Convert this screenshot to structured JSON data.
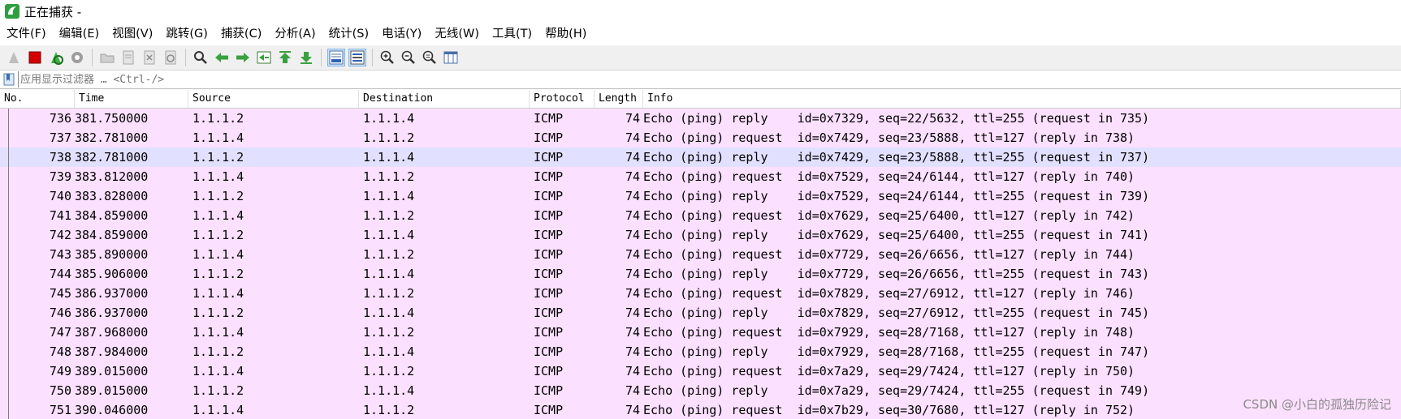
{
  "window": {
    "title": "正在捕获 -"
  },
  "menu": [
    "文件(F)",
    "编辑(E)",
    "视图(V)",
    "跳转(G)",
    "捕获(C)",
    "分析(A)",
    "统计(S)",
    "电话(Y)",
    "无线(W)",
    "工具(T)",
    "帮助(H)"
  ],
  "toolbar": [
    {
      "name": "start-capture-icon",
      "group": 1
    },
    {
      "name": "stop-capture-icon",
      "group": 1
    },
    {
      "name": "restart-capture-icon",
      "group": 1
    },
    {
      "name": "capture-options-icon",
      "group": 1
    },
    {
      "name": "open-file-icon",
      "group": 2
    },
    {
      "name": "save-file-icon",
      "group": 2
    },
    {
      "name": "close-file-icon",
      "group": 2
    },
    {
      "name": "reload-file-icon",
      "group": 2
    },
    {
      "name": "find-packet-icon",
      "group": 3
    },
    {
      "name": "go-back-icon",
      "group": 3
    },
    {
      "name": "go-forward-icon",
      "group": 3
    },
    {
      "name": "go-to-packet-icon",
      "group": 3
    },
    {
      "name": "go-first-icon",
      "group": 3
    },
    {
      "name": "go-last-icon",
      "group": 3
    },
    {
      "name": "auto-scroll-icon",
      "group": 4,
      "pressed": true
    },
    {
      "name": "colorize-icon",
      "group": 4,
      "pressed": true
    },
    {
      "name": "zoom-in-icon",
      "group": 5
    },
    {
      "name": "zoom-out-icon",
      "group": 5
    },
    {
      "name": "zoom-normal-icon",
      "group": 5
    },
    {
      "name": "resize-columns-icon",
      "group": 5
    }
  ],
  "filter": {
    "placeholder": "应用显示过滤器 … <Ctrl-/>"
  },
  "columns": [
    "No.",
    "Time",
    "Source",
    "Destination",
    "Protocol",
    "Length",
    "Info"
  ],
  "packets": [
    {
      "no": "736",
      "time": "381.750000",
      "src": "1.1.1.2",
      "dst": "1.1.1.4",
      "proto": "ICMP",
      "len": "74",
      "info": "Echo (ping) reply    id=0x7329, seq=22/5632, ttl=255 (request in 735)"
    },
    {
      "no": "737",
      "time": "382.781000",
      "src": "1.1.1.4",
      "dst": "1.1.1.2",
      "proto": "ICMP",
      "len": "74",
      "info": "Echo (ping) request  id=0x7429, seq=23/5888, ttl=127 (reply in 738)"
    },
    {
      "no": "738",
      "time": "382.781000",
      "src": "1.1.1.2",
      "dst": "1.1.1.4",
      "proto": "ICMP",
      "len": "74",
      "info": "Echo (ping) reply    id=0x7429, seq=23/5888, ttl=255 (request in 737)",
      "selected": true
    },
    {
      "no": "739",
      "time": "383.812000",
      "src": "1.1.1.4",
      "dst": "1.1.1.2",
      "proto": "ICMP",
      "len": "74",
      "info": "Echo (ping) request  id=0x7529, seq=24/6144, ttl=127 (reply in 740)"
    },
    {
      "no": "740",
      "time": "383.828000",
      "src": "1.1.1.2",
      "dst": "1.1.1.4",
      "proto": "ICMP",
      "len": "74",
      "info": "Echo (ping) reply    id=0x7529, seq=24/6144, ttl=255 (request in 739)"
    },
    {
      "no": "741",
      "time": "384.859000",
      "src": "1.1.1.4",
      "dst": "1.1.1.2",
      "proto": "ICMP",
      "len": "74",
      "info": "Echo (ping) request  id=0x7629, seq=25/6400, ttl=127 (reply in 742)"
    },
    {
      "no": "742",
      "time": "384.859000",
      "src": "1.1.1.2",
      "dst": "1.1.1.4",
      "proto": "ICMP",
      "len": "74",
      "info": "Echo (ping) reply    id=0x7629, seq=25/6400, ttl=255 (request in 741)"
    },
    {
      "no": "743",
      "time": "385.890000",
      "src": "1.1.1.4",
      "dst": "1.1.1.2",
      "proto": "ICMP",
      "len": "74",
      "info": "Echo (ping) request  id=0x7729, seq=26/6656, ttl=127 (reply in 744)"
    },
    {
      "no": "744",
      "time": "385.906000",
      "src": "1.1.1.2",
      "dst": "1.1.1.4",
      "proto": "ICMP",
      "len": "74",
      "info": "Echo (ping) reply    id=0x7729, seq=26/6656, ttl=255 (request in 743)"
    },
    {
      "no": "745",
      "time": "386.937000",
      "src": "1.1.1.4",
      "dst": "1.1.1.2",
      "proto": "ICMP",
      "len": "74",
      "info": "Echo (ping) request  id=0x7829, seq=27/6912, ttl=127 (reply in 746)"
    },
    {
      "no": "746",
      "time": "386.937000",
      "src": "1.1.1.2",
      "dst": "1.1.1.4",
      "proto": "ICMP",
      "len": "74",
      "info": "Echo (ping) reply    id=0x7829, seq=27/6912, ttl=255 (request in 745)"
    },
    {
      "no": "747",
      "time": "387.968000",
      "src": "1.1.1.4",
      "dst": "1.1.1.2",
      "proto": "ICMP",
      "len": "74",
      "info": "Echo (ping) request  id=0x7929, seq=28/7168, ttl=127 (reply in 748)"
    },
    {
      "no": "748",
      "time": "387.984000",
      "src": "1.1.1.2",
      "dst": "1.1.1.4",
      "proto": "ICMP",
      "len": "74",
      "info": "Echo (ping) reply    id=0x7929, seq=28/7168, ttl=255 (request in 747)"
    },
    {
      "no": "749",
      "time": "389.015000",
      "src": "1.1.1.4",
      "dst": "1.1.1.2",
      "proto": "ICMP",
      "len": "74",
      "info": "Echo (ping) request  id=0x7a29, seq=29/7424, ttl=127 (reply in 750)"
    },
    {
      "no": "750",
      "time": "389.015000",
      "src": "1.1.1.2",
      "dst": "1.1.1.4",
      "proto": "ICMP",
      "len": "74",
      "info": "Echo (ping) reply    id=0x7a29, seq=29/7424, ttl=255 (request in 749)"
    },
    {
      "no": "751",
      "time": "390.046000",
      "src": "1.1.1.4",
      "dst": "1.1.1.2",
      "proto": "ICMP",
      "len": "74",
      "info": "Echo (ping) request  id=0x7b29, seq=30/7680, ttl=127 (reply in 752)"
    }
  ],
  "watermark": "CSDN @小白的孤独历险记",
  "colors": {
    "row_bg": "#fce0ff",
    "row_selected_bg": "#e2e0ff",
    "accent": "#2e7d32"
  }
}
